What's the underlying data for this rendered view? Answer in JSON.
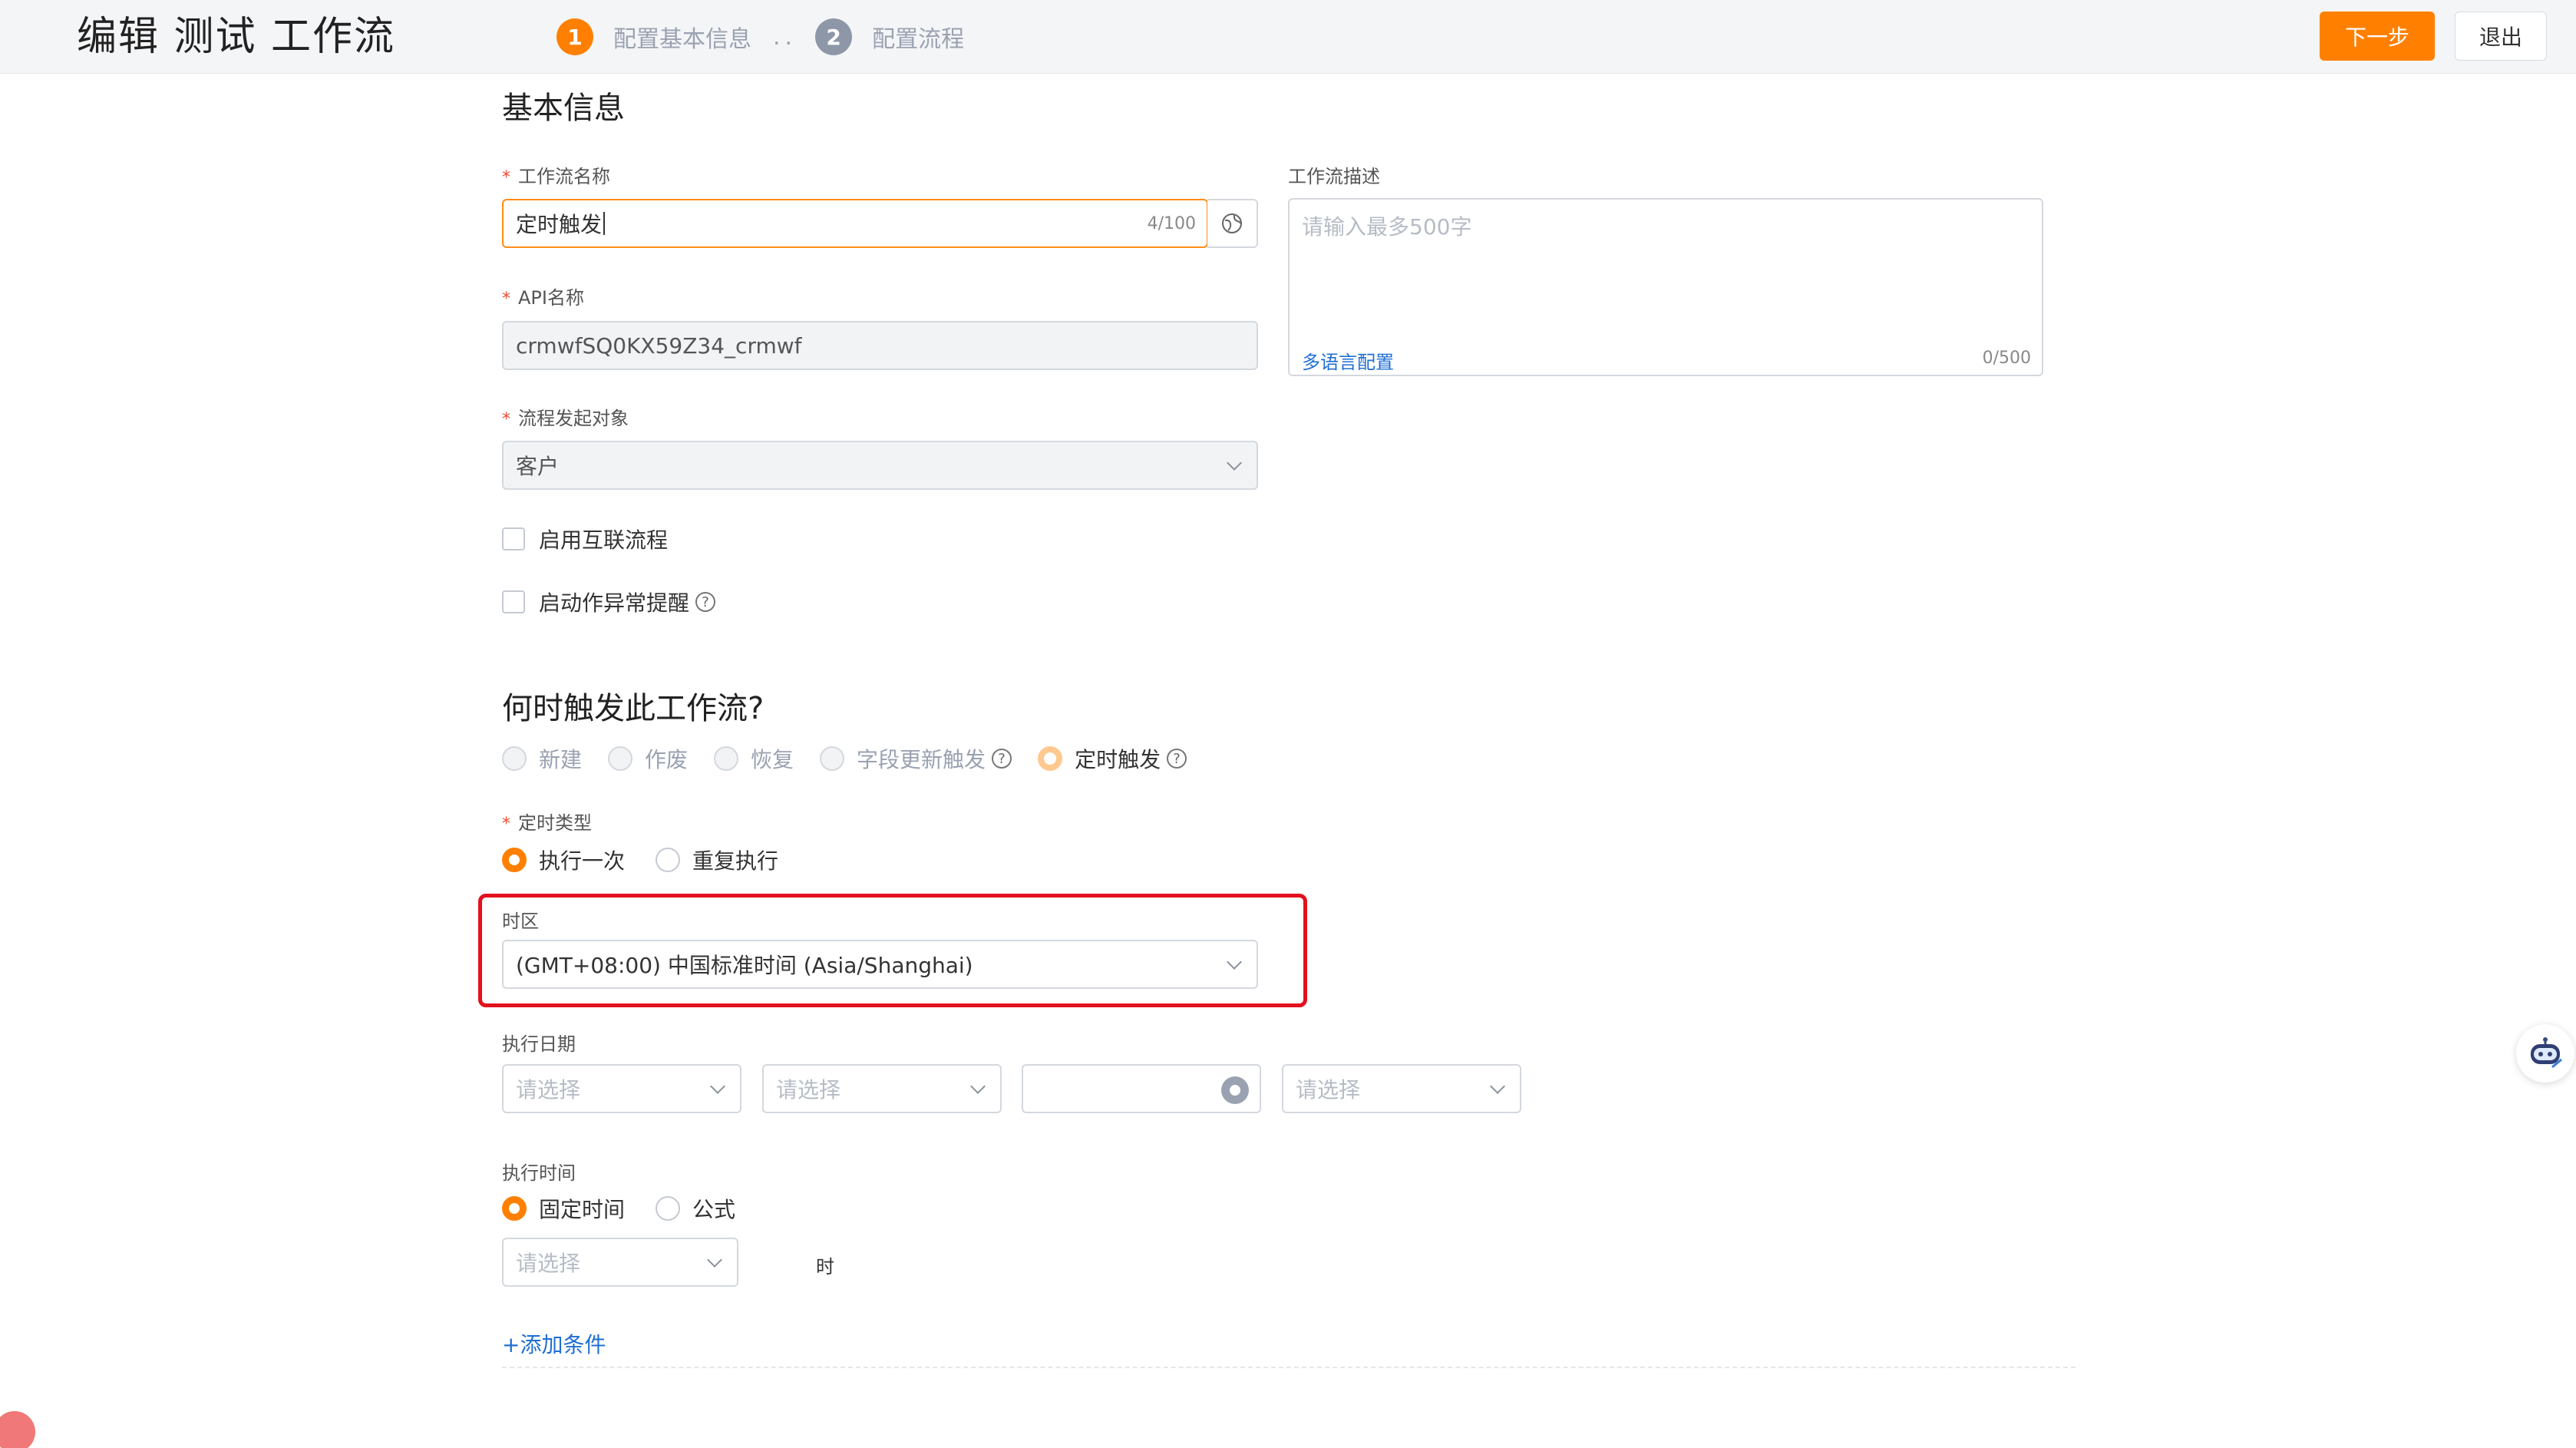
{
  "header": {
    "title": "编辑 测试 工作流",
    "steps": [
      {
        "number": "1",
        "label": "配置基本信息"
      },
      {
        "number": "2",
        "label": "配置流程"
      }
    ],
    "separator": "..",
    "next_label": "下一步",
    "exit_label": "退出"
  },
  "basic": {
    "section_title": "基本信息",
    "name_label": "工作流名称",
    "name_value": "定时触发",
    "name_counter": "4/100",
    "api_label": "API名称",
    "api_value": "crmwfSQ0KX59Z34_crmwf",
    "target_label": "流程发起对象",
    "target_value": "客户",
    "desc_label": "工作流描述",
    "desc_placeholder": "请输入最多500字",
    "desc_link": "多语言配置",
    "desc_counter": "0/500",
    "checkbox_interconnect": "启用互联流程",
    "checkbox_alert": "启动作异常提醒",
    "required_mark": "*"
  },
  "trigger": {
    "section_title": "何时触发此工作流?",
    "options": [
      "新建",
      "作废",
      "恢复",
      "字段更新触发",
      "定时触发"
    ],
    "selected": "定时触发",
    "help_mark": "?"
  },
  "schedule": {
    "type_label": "定时类型",
    "type_options": [
      "执行一次",
      "重复执行"
    ],
    "type_selected": "执行一次",
    "timezone_label": "时区",
    "timezone_value": "(GMT+08:00) 中国标准时间 (Asia/Shanghai)",
    "date_label": "执行日期",
    "date_placeholder": "请选择",
    "time_label": "执行时间",
    "time_options": [
      "固定时间",
      "公式"
    ],
    "time_selected": "固定时间",
    "time_placeholder": "请选择",
    "hour_unit": "时",
    "add_condition": "+添加条件"
  },
  "colors": {
    "accent": "#ff8000",
    "highlight": "#e3101d",
    "link": "#1f6fd1"
  },
  "icons": [
    "globe-icon",
    "help-icon",
    "chevron-down-icon",
    "gear-icon",
    "robot-assistant-icon"
  ]
}
